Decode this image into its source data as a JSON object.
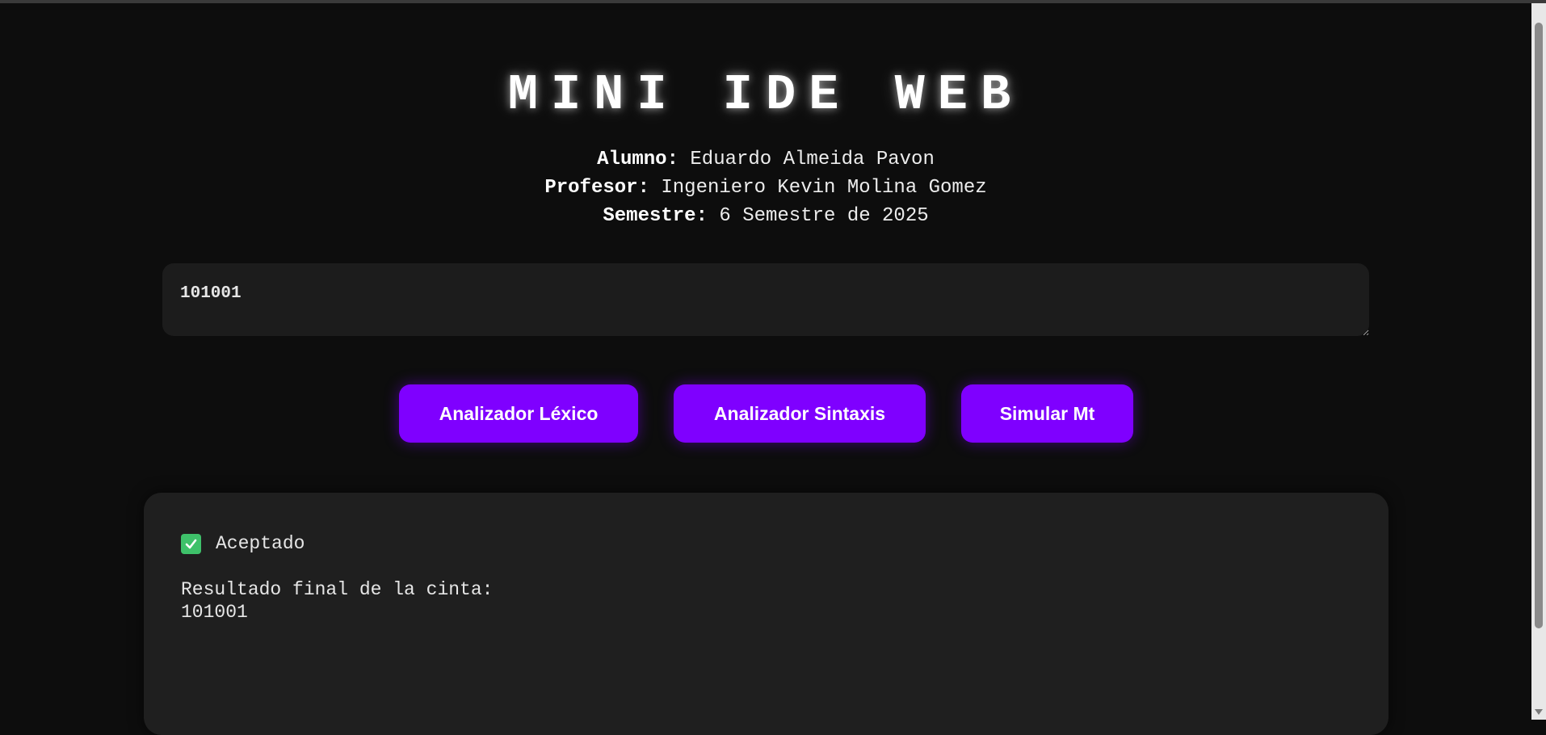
{
  "header": {
    "title": "MINI IDE WEB",
    "alumno_label": "Alumno:",
    "alumno_value": "Eduardo Almeida Pavon",
    "profesor_label": "Profesor:",
    "profesor_value": "Ingeniero Kevin Molina Gomez",
    "semestre_label": "Semestre:",
    "semestre_value": "6 Semestre de 2025"
  },
  "editor": {
    "value": "101001"
  },
  "buttons": {
    "lexico": "Analizador Léxico",
    "sintaxis": "Analizador Sintaxis",
    "simular": "Simular Mt"
  },
  "output": {
    "status": "Aceptado",
    "result_label": "Resultado final de la cinta:",
    "result_value": "101001"
  },
  "colors": {
    "background": "#0d0d0d",
    "accent": "#7f00ff",
    "success": "#3ec16a",
    "panel": "#1f1f1f"
  },
  "icons": {
    "status": "check-icon"
  }
}
